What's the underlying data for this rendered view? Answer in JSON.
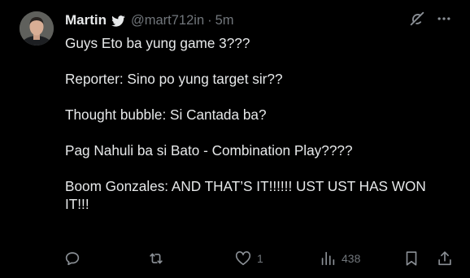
{
  "author": {
    "name": "Martin",
    "handle": "@mart712in",
    "separator": "·",
    "time": "5m"
  },
  "icons": {
    "verified": "bird-badge-icon",
    "grok": "grok-slash-icon",
    "more": "more-dots-icon",
    "reply": "reply-icon",
    "repost": "repost-icon",
    "like": "heart-icon",
    "views": "views-chart-icon",
    "bookmark": "bookmark-icon",
    "share": "share-icon"
  },
  "tweet": {
    "lines": [
      "Guys Eto ba yung game 3???",
      "Reporter: Sino po yung target sir??",
      "Thought bubble: Si Cantada ba?",
      "Pag Nahuli ba si Bato - Combination Play????",
      "Boom Gonzales: AND THAT’S IT!!!!!! UST UST HAS WON IT!!!"
    ]
  },
  "actions": {
    "reply_count": "",
    "repost_count": "",
    "like_count": "1",
    "view_count": "438"
  },
  "colors": {
    "background": "#000000",
    "text": "#e7e9ea",
    "muted": "#71767b"
  }
}
